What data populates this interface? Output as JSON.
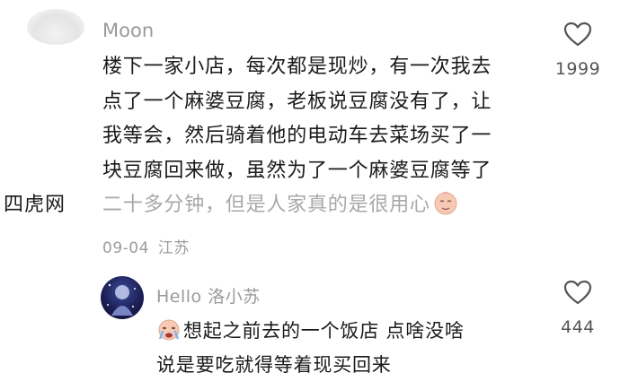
{
  "comment": {
    "username": "Moon",
    "lines": [
      "楼下一家小店，每次都是现炒，有一次我去",
      "点了一个麻婆豆腐，老板说豆腐没有了，让",
      "我等会，然后骑着他的电动车去菜场买了一",
      "块豆腐回来做，虽然为了一个麻婆豆腐等了",
      "二十多分钟，但是人家真的是很用心"
    ],
    "emoji": "touched-emoji-icon",
    "date": "09-04",
    "location": "江苏",
    "likes": "1999"
  },
  "watermark": "四虎网",
  "reply": {
    "username": "Hello 洛小苏",
    "lines": [
      "想起之前去的一个饭店 点啥没啥",
      "说是要吃就得等着现买回来"
    ],
    "emoji": "crying-emoji-icon",
    "likes": "444"
  },
  "colors": {
    "text": "#1a1a1a",
    "secondary": "#9a9a9a",
    "heart_stroke": "#555555"
  }
}
